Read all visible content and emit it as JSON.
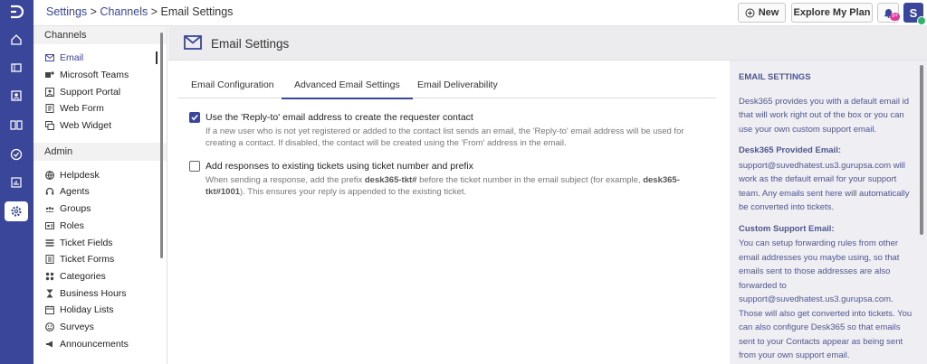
{
  "topbar": {
    "breadcrumb": {
      "part1": "Settings",
      "sep1": " > ",
      "part2": "Channels",
      "sep2": " > ",
      "current": "Email Settings"
    },
    "new_label": "New",
    "explore_label": "Explore My Plan",
    "notif_badge": "9+",
    "avatar_initial": "S"
  },
  "sidebar": {
    "channels_title": "Channels",
    "channels": [
      {
        "label": "Email",
        "icon": "mail-icon"
      },
      {
        "label": "Microsoft Teams",
        "icon": "teams-icon"
      },
      {
        "label": "Support Portal",
        "icon": "portal-icon"
      },
      {
        "label": "Web Form",
        "icon": "form-icon"
      },
      {
        "label": "Web Widget",
        "icon": "widget-icon"
      }
    ],
    "admin_title": "Admin",
    "admin": [
      {
        "label": "Helpdesk",
        "icon": "globe-icon"
      },
      {
        "label": "Agents",
        "icon": "headset-icon"
      },
      {
        "label": "Groups",
        "icon": "groups-icon"
      },
      {
        "label": "Roles",
        "icon": "roles-icon"
      },
      {
        "label": "Ticket Fields",
        "icon": "fields-icon"
      },
      {
        "label": "Ticket Forms",
        "icon": "forms-icon"
      },
      {
        "label": "Categories",
        "icon": "categories-icon"
      },
      {
        "label": "Business Hours",
        "icon": "hourglass-icon"
      },
      {
        "label": "Holiday Lists",
        "icon": "calendar-icon"
      },
      {
        "label": "Surveys",
        "icon": "surveys-icon"
      },
      {
        "label": "Announcements",
        "icon": "megaphone-icon"
      }
    ]
  },
  "page": {
    "title": "Email Settings",
    "tabs": [
      {
        "label": "Email Configuration",
        "active": false
      },
      {
        "label": "Advanced Email Settings",
        "active": true
      },
      {
        "label": "Email Deliverability",
        "active": false
      }
    ],
    "options": [
      {
        "label": "Use the 'Reply-to' email address to create the requester contact",
        "checked": true,
        "desc": "If a new user who is not yet registered or added to the contact list sends an email, the 'Reply-to' email address will be used for creating a contact. If disabled, the contact will be created using the 'From' address in the email."
      },
      {
        "label": "Add responses to existing tickets using ticket number and prefix",
        "checked": false,
        "desc_a": "When sending a response, add the prefix ",
        "desc_b": "desk365-tkt#",
        "desc_c": " before the ticket number in the email subject (for example, ",
        "desc_d": "desk365-tkt#1001",
        "desc_e": "). This ensures your reply is appended to the existing ticket."
      }
    ]
  },
  "info": {
    "heading": "EMAIL SETTINGS",
    "intro": "Desk365 provides you with a default email id that will work right out of the box or you can use your own custom support email.",
    "provided_heading": "Desk365 Provided Email:",
    "provided_text": "support@suvedhatest.us3.gurupsa.com will work as the default email for your support team. Any emails sent here will automatically be converted into tickets.",
    "custom_heading": "Custom Support Email:",
    "custom_text": "You can setup forwarding rules from other email addresses you maybe using, so that emails sent to those addresses are also forwarded to support@suvedhatest.us3.gurupsa.com. Those will also get converted into tickets. You can also configure Desk365 so that emails sent to your Contacts appear as being sent from your own support email."
  },
  "colors": {
    "accent": "#3a4699",
    "badge": "#e0399a",
    "online": "#2db36b"
  }
}
